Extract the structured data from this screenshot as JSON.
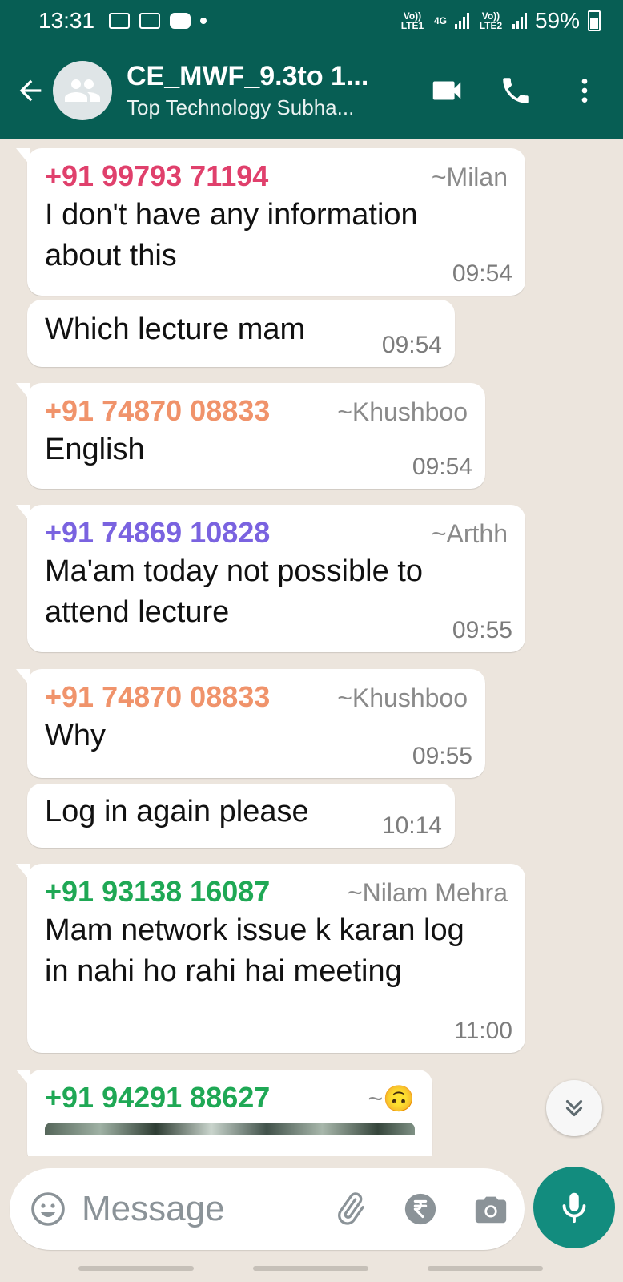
{
  "status_bar": {
    "time": "13:31",
    "sim1_label": "Vo)) LTE1",
    "network": "4G",
    "sim2_label": "Vo)) LTE2",
    "battery": "59%"
  },
  "header": {
    "title": "CE_MWF_9.3to 1...",
    "subtitle": "Top Technology  Subha..."
  },
  "messages": [
    {
      "phone": "+91 99793 71194",
      "phone_color": "#E0406C",
      "name": "~Milan",
      "text": "I don't have any information about this",
      "time": "09:54"
    },
    {
      "text": "Which lecture mam",
      "time": "09:54"
    },
    {
      "phone": "+91 74870 08833",
      "phone_color": "#F0936B",
      "name": "~Khushboo",
      "text": "English",
      "time": "09:54"
    },
    {
      "phone": "+91 74869 10828",
      "phone_color": "#7A63E0",
      "name": "~Arthh",
      "text": "Ma'am today not possible to attend lecture",
      "time": "09:55"
    },
    {
      "phone": "+91 74870 08833",
      "phone_color": "#F0936B",
      "name": "~Khushboo",
      "text": "Why",
      "time": "09:55"
    },
    {
      "text": "Log in again please",
      "time": "10:14"
    },
    {
      "phone": "+91 93138 16087",
      "phone_color": "#1FA855",
      "name": "~Nilam Mehra",
      "text": "Mam network issue k karan log in nahi ho rahi hai meeting",
      "time": "11:00"
    },
    {
      "phone": "+91 94291 88627",
      "phone_color": "#1FA855",
      "name": "~🙃"
    }
  ],
  "input": {
    "placeholder": "Message"
  },
  "colors": {
    "header_bg": "#075E54",
    "chat_bg": "#ECE5DD",
    "mic_bg": "#128C7E"
  }
}
